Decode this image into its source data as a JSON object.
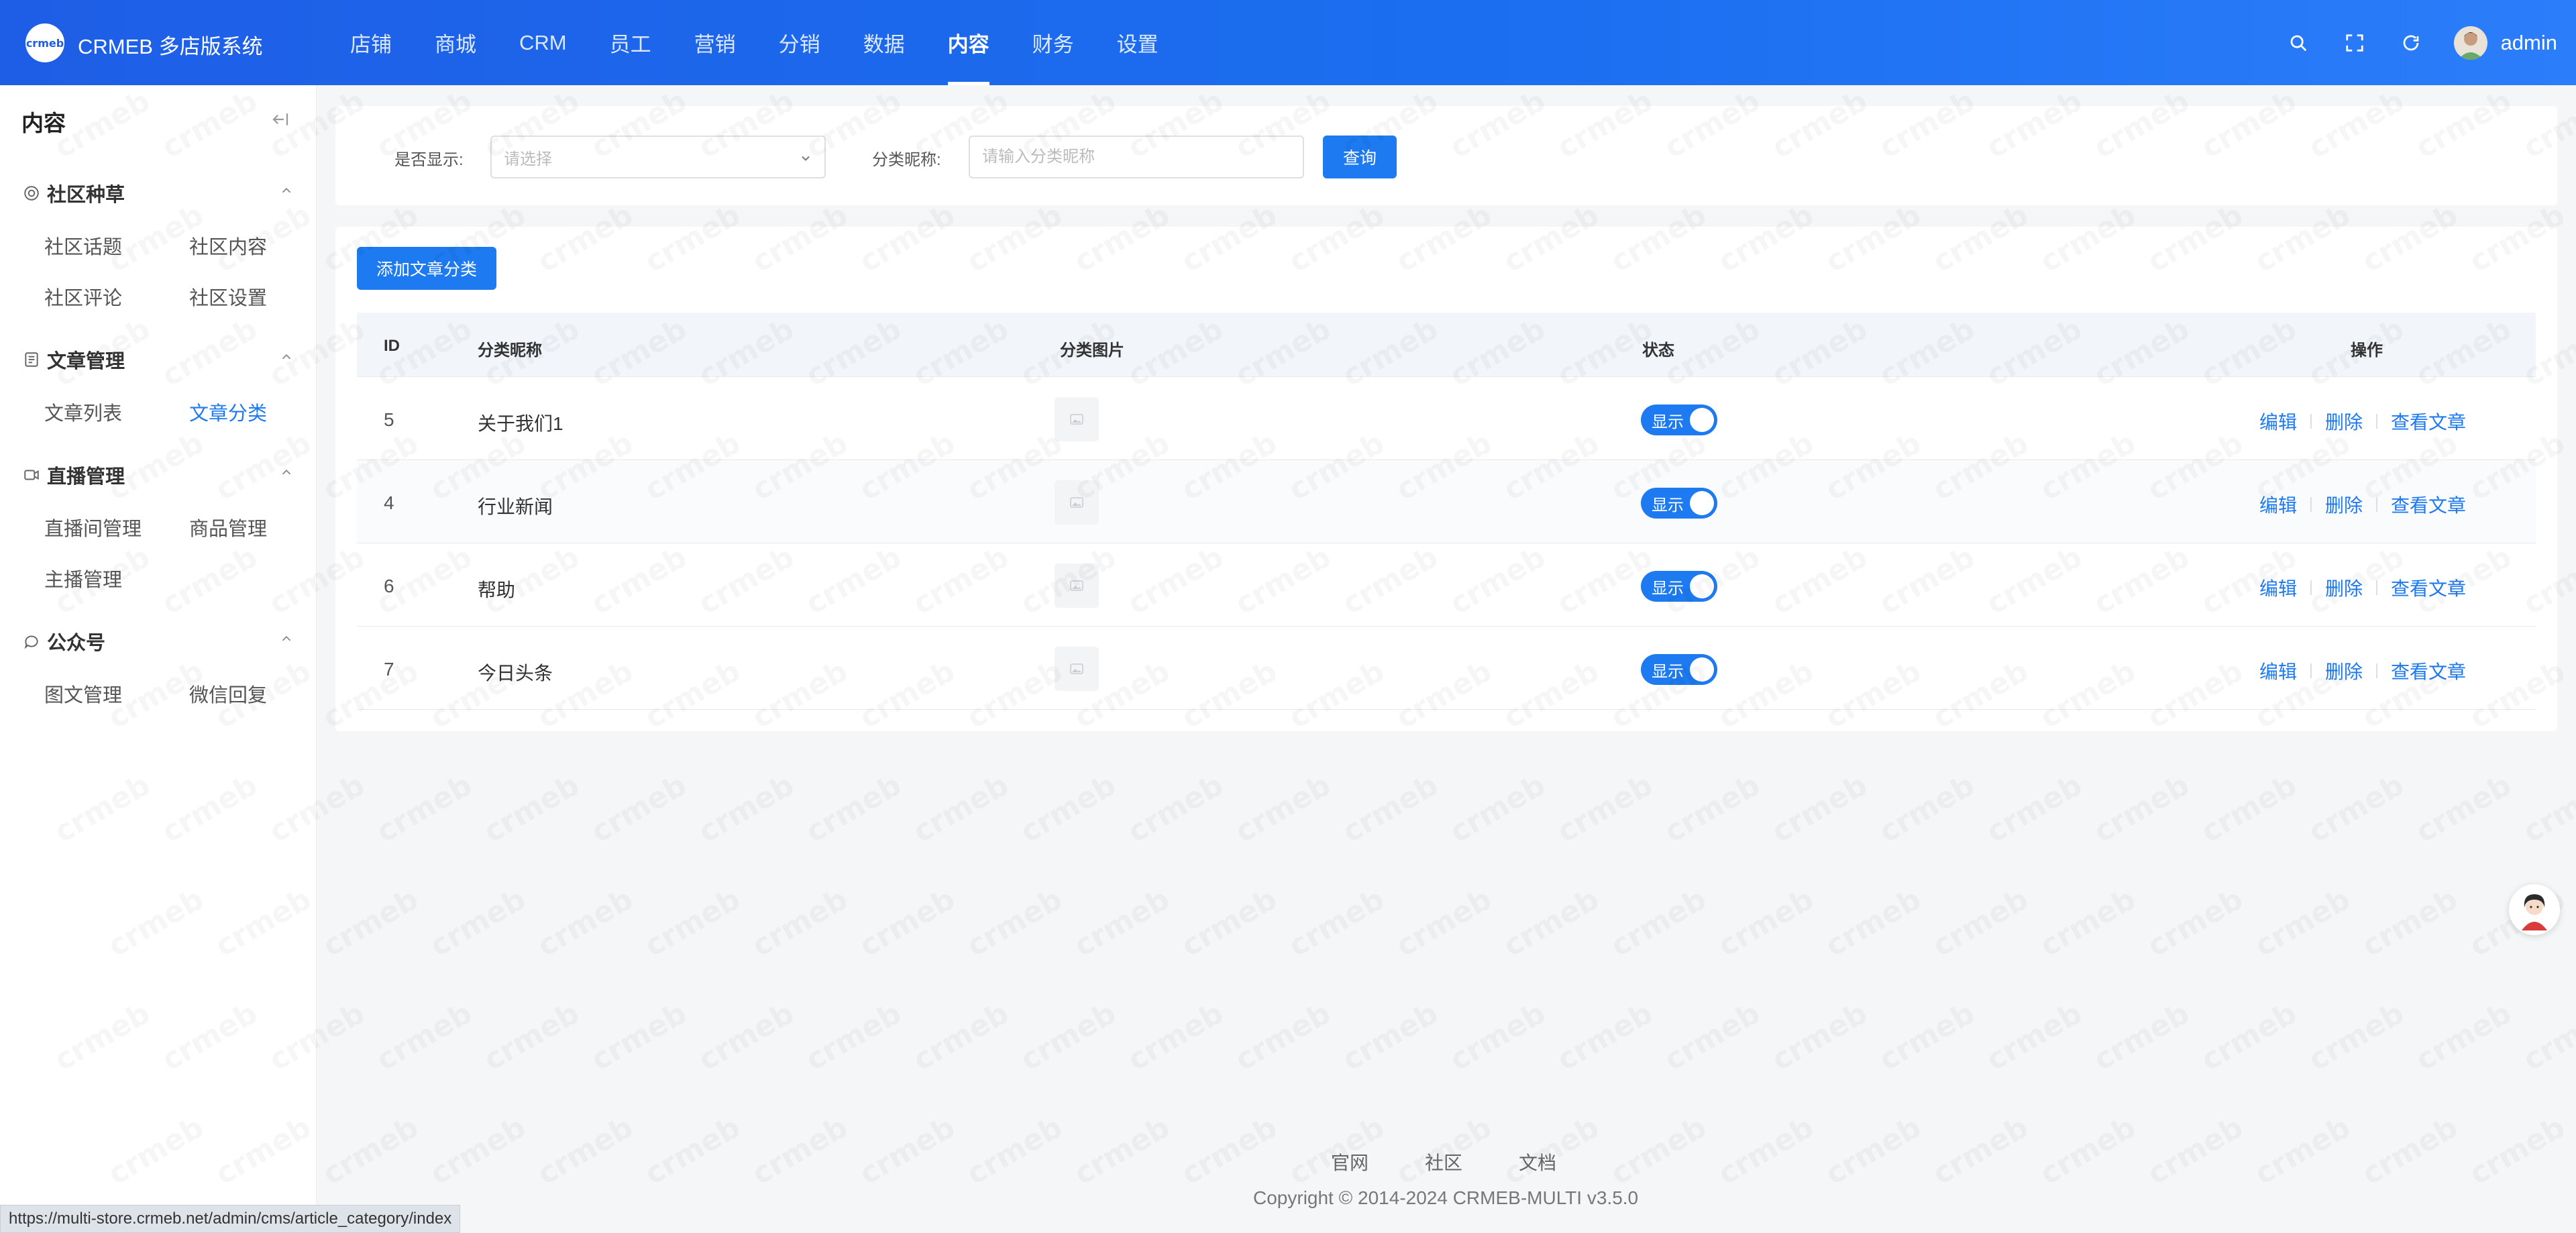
{
  "header": {
    "logo_mark": "crmeb",
    "app_name": "CRMEB 多店版系统",
    "nav": [
      {
        "label": "店铺"
      },
      {
        "label": "商城"
      },
      {
        "label": "CRM"
      },
      {
        "label": "员工"
      },
      {
        "label": "营销"
      },
      {
        "label": "分销"
      },
      {
        "label": "数据"
      },
      {
        "label": "内容",
        "active": true
      },
      {
        "label": "财务"
      },
      {
        "label": "设置"
      }
    ],
    "user_name": "admin"
  },
  "sidebar": {
    "title": "内容",
    "groups": [
      {
        "label": "社区种草",
        "icon": "target-icon",
        "items": [
          "社区话题",
          "社区内容",
          "社区评论",
          "社区设置"
        ]
      },
      {
        "label": "文章管理",
        "icon": "document-icon",
        "items": [
          "文章列表",
          "文章分类"
        ],
        "active_item": "文章分类"
      },
      {
        "label": "直播管理",
        "icon": "video-icon",
        "items": [
          "直播间管理",
          "商品管理",
          "主播管理"
        ]
      },
      {
        "label": "公众号",
        "icon": "chat-icon",
        "items": [
          "图文管理",
          "微信回复"
        ]
      }
    ]
  },
  "filter": {
    "display_label": "是否显示:",
    "display_placeholder": "请选择",
    "name_label": "分类昵称:",
    "name_placeholder": "请输入分类昵称",
    "query_button": "查询"
  },
  "toolbar": {
    "add_button": "添加文章分类"
  },
  "table": {
    "columns": [
      "ID",
      "分类昵称",
      "分类图片",
      "状态",
      "操作"
    ],
    "rows": [
      {
        "id": "5",
        "name": "关于我们1",
        "status": "显示"
      },
      {
        "id": "4",
        "name": "行业新闻",
        "status": "显示"
      },
      {
        "id": "6",
        "name": "帮助",
        "status": "显示"
      },
      {
        "id": "7",
        "name": "今日头条",
        "status": "显示"
      }
    ],
    "actions": {
      "edit": "编辑",
      "delete": "删除",
      "view": "查看文章"
    }
  },
  "footer": {
    "links": [
      "官网",
      "社区",
      "文档"
    ],
    "copyright": "Copyright © 2014-2024 CRMEB-MULTI v3.5.0"
  },
  "status_url": "https://multi-store.crmeb.net/admin/cms/article_category/index",
  "colors": {
    "primary": "#1e7af0",
    "header_start": "#1e5ee6",
    "header_end": "#2c7dfa"
  }
}
